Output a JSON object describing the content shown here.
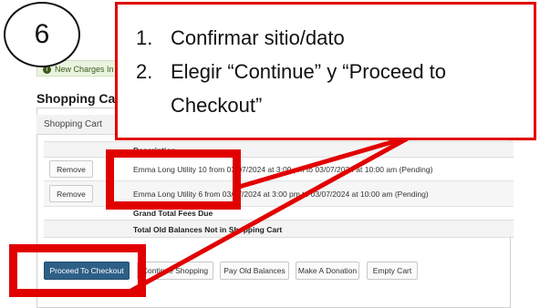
{
  "step_number": "6",
  "alert": {
    "text": "New Charges In S",
    "icon": "info-icon"
  },
  "cart_title": "Shopping Cart",
  "panel_header": "Shopping Cart",
  "table": {
    "column_header": "Description",
    "rows": [
      {
        "action": "Remove",
        "description": "Emma Long Utility 10 from 03/07/2024 at 3:00 pm to 03/07/2024 at 10:00 am (Pending)"
      },
      {
        "action": "Remove",
        "description": "Emma Long Utility 6 from 03/07/2024 at 3:00 pm to 03/07/2024 at 10:00 am (Pending)"
      }
    ],
    "grand_total_label": "Grand Total Fees Due",
    "old_balances_label": "Total Old Balances Not in Shopping Cart"
  },
  "buttons": {
    "checkout": "Proceed To Checkout",
    "continue": "Continue Shopping",
    "pay_old": "Pay Old Balances",
    "donation": "Make A Donation",
    "empty": "Empty Cart"
  },
  "instructions": [
    {
      "num": "1.",
      "text": "Confirmar sitio/dato"
    },
    {
      "num": "2.",
      "text": "Elegir “Continue” y “Proceed to"
    },
    {
      "num": "",
      "text": "Checkout”"
    }
  ],
  "colors": {
    "annotation_red": "#e10000",
    "primary_button": "#2e5f86"
  }
}
